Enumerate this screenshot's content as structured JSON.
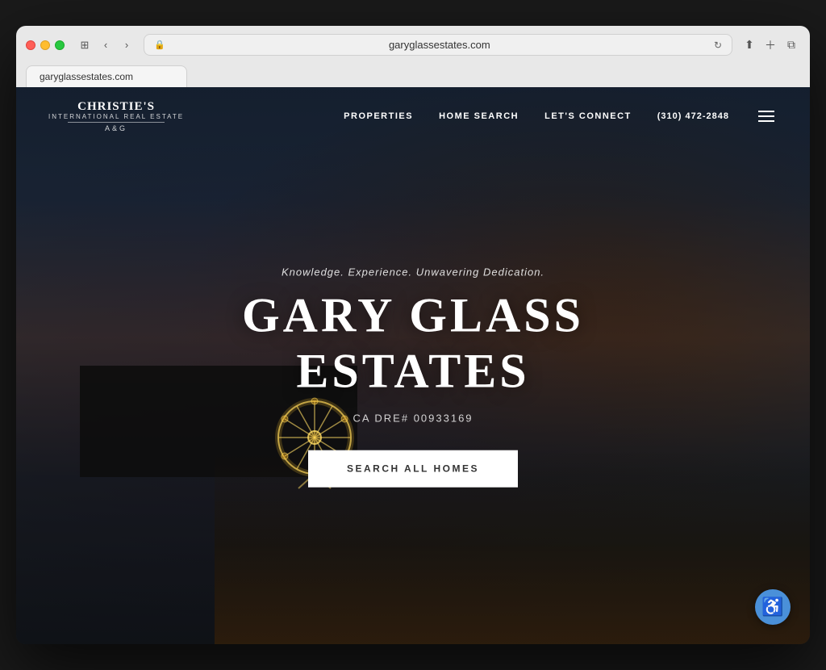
{
  "browser": {
    "url": "garyglassestates.com",
    "tab_label": "garyglassestates.com"
  },
  "nav": {
    "logo": {
      "line1": "CHRISTIE'S",
      "line2": "INTERNATIONAL REAL ESTATE",
      "line3": "A&G"
    },
    "links": [
      {
        "label": "PROPERTIES",
        "id": "nav-properties"
      },
      {
        "label": "HOME SEARCH",
        "id": "nav-home-search"
      },
      {
        "label": "LET'S CONNECT",
        "id": "nav-lets-connect"
      }
    ],
    "phone": "(310) 472-2848"
  },
  "hero": {
    "tagline": "Knowledge. Experience. Unwavering Dedication.",
    "title": "GARY GLASS ESTATES",
    "dre": "CA DRE# 00933169",
    "cta_button": "SEARCH ALL HOMES"
  },
  "accessibility": {
    "label": "Accessibility Menu",
    "icon": "♿"
  }
}
